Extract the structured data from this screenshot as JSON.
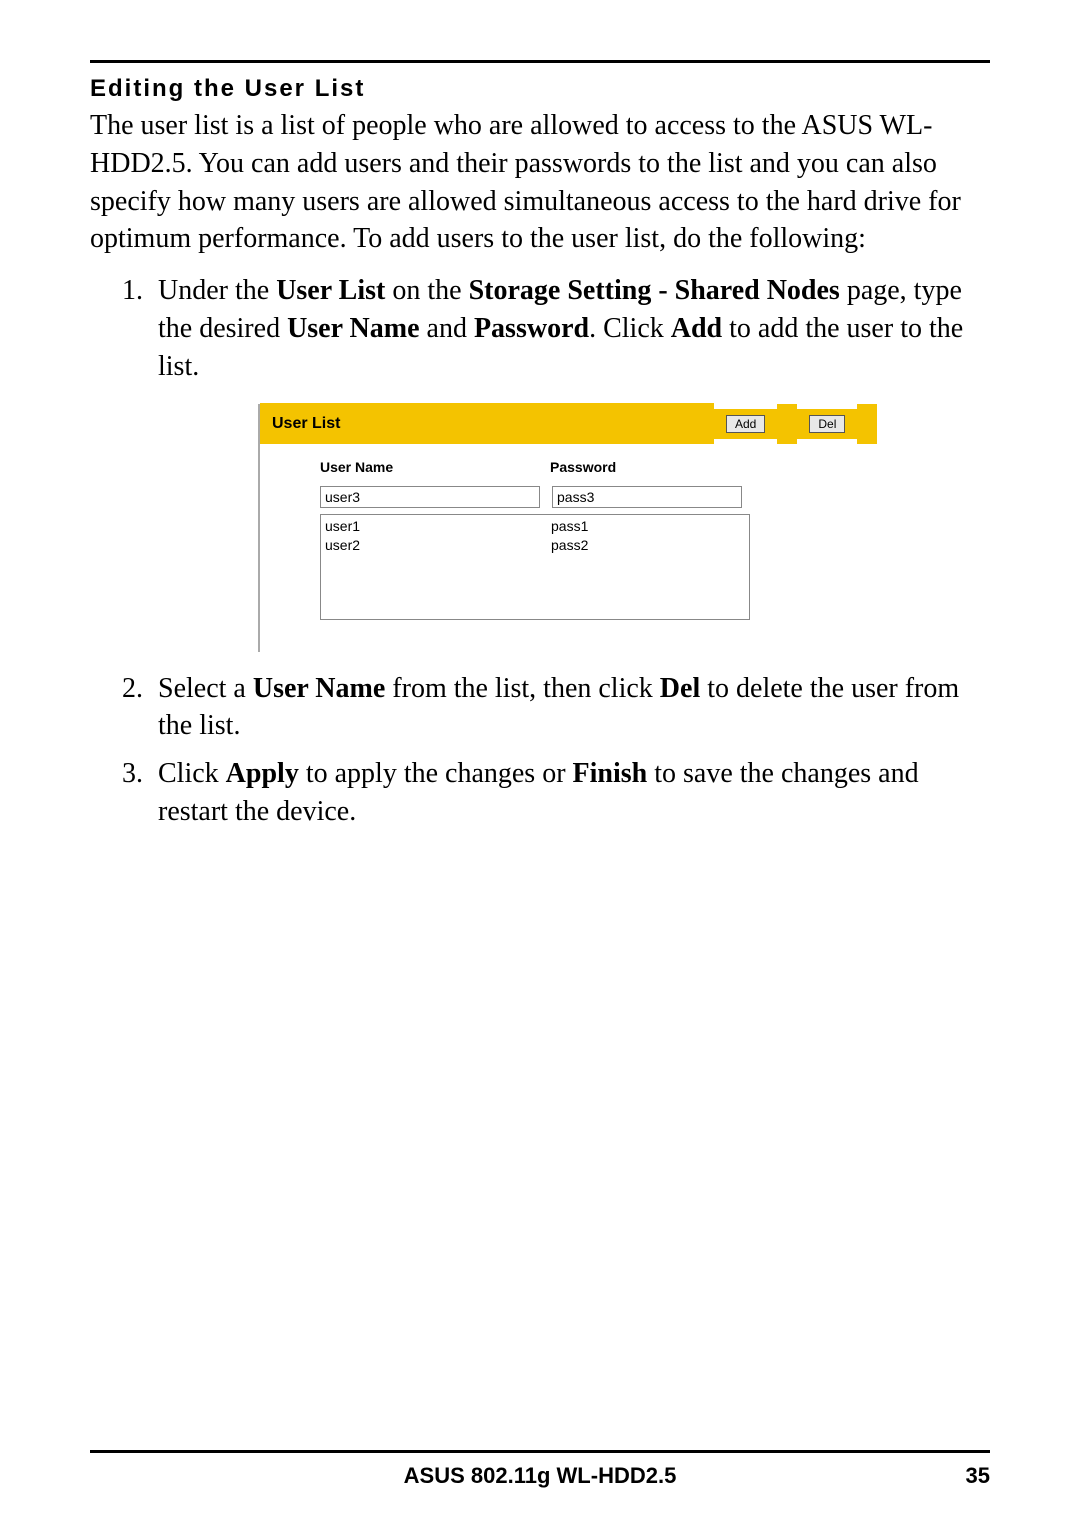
{
  "heading": "Editing the User List",
  "intro": "The user list is a list of people who are allowed to access to the ASUS WL-HDD2.5. You can add users and their passwords to the list and you can also specify how many users are allowed simultaneous access to the hard drive for optimum performance. To add users to the user list, do the following:",
  "step1_pre": "Under the ",
  "step1_b1": "User List",
  "step1_mid1": " on the ",
  "step1_b2": "Storage Setting - Shared Nodes",
  "step1_mid2": " page, type the desired ",
  "step1_b3": "User Name",
  "step1_mid3": " and ",
  "step1_b4": "Password",
  "step1_mid4": ". Click ",
  "step1_b5": "Add",
  "step1_end": " to add the user to the list.",
  "step2_pre": "Select a ",
  "step2_b1": "User Name",
  "step2_mid": " from the list, then click ",
  "step2_b2": "Del",
  "step2_end": " to delete the user from the list.",
  "step3_pre": "Click ",
  "step3_b1": "Apply",
  "step3_mid": " to apply the changes or ",
  "step3_b2": "Finish",
  "step3_end": " to save the changes and restart the device.",
  "figure": {
    "title": "User List",
    "add_btn": "Add",
    "del_btn": "Del",
    "col_user": "User Name",
    "col_pass": "Password",
    "input_user": "user3",
    "input_pass": "pass3",
    "rows": [
      {
        "user": "user1",
        "pass": "pass1"
      },
      {
        "user": "user2",
        "pass": "pass2"
      }
    ]
  },
  "footer_title": "ASUS 802.11g WL-HDD2.5",
  "page_number": "35"
}
